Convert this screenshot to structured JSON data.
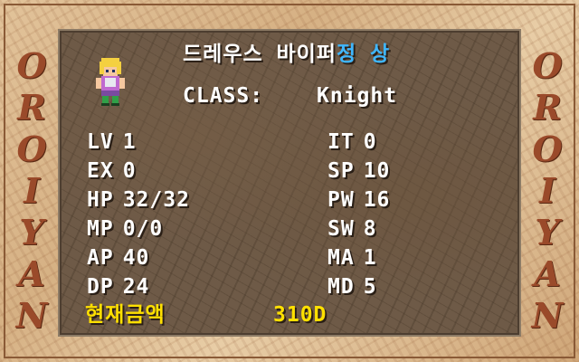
{
  "side_title": [
    "O",
    "R",
    "O",
    "I",
    "Y",
    "A",
    "N"
  ],
  "header": {
    "name": "드레우스 바이퍼",
    "status": "정 상",
    "class_label": "CLASS:",
    "class_value": "Knight"
  },
  "stats_left": [
    {
      "label": "LV",
      "value": "1"
    },
    {
      "label": "EX",
      "value": "0"
    },
    {
      "label": "HP",
      "value": "32/32"
    },
    {
      "label": "MP",
      "value": "0/0"
    },
    {
      "label": "AP",
      "value": "40"
    },
    {
      "label": "DP",
      "value": "24"
    }
  ],
  "stats_right": [
    {
      "label": "IT",
      "value": "0"
    },
    {
      "label": "SP",
      "value": "10"
    },
    {
      "label": "PW",
      "value": "16"
    },
    {
      "label": "SW",
      "value": "8"
    },
    {
      "label": "MA",
      "value": "1"
    },
    {
      "label": "MD",
      "value": "5"
    }
  ],
  "money": {
    "label": "현재금액",
    "value": "310D"
  },
  "colors": {
    "text": "#ffffff",
    "status": "#3fb6ff",
    "money": "#ffe000",
    "side_title": "#9a4a2a"
  },
  "icons": {
    "avatar": "knight-sprite"
  }
}
